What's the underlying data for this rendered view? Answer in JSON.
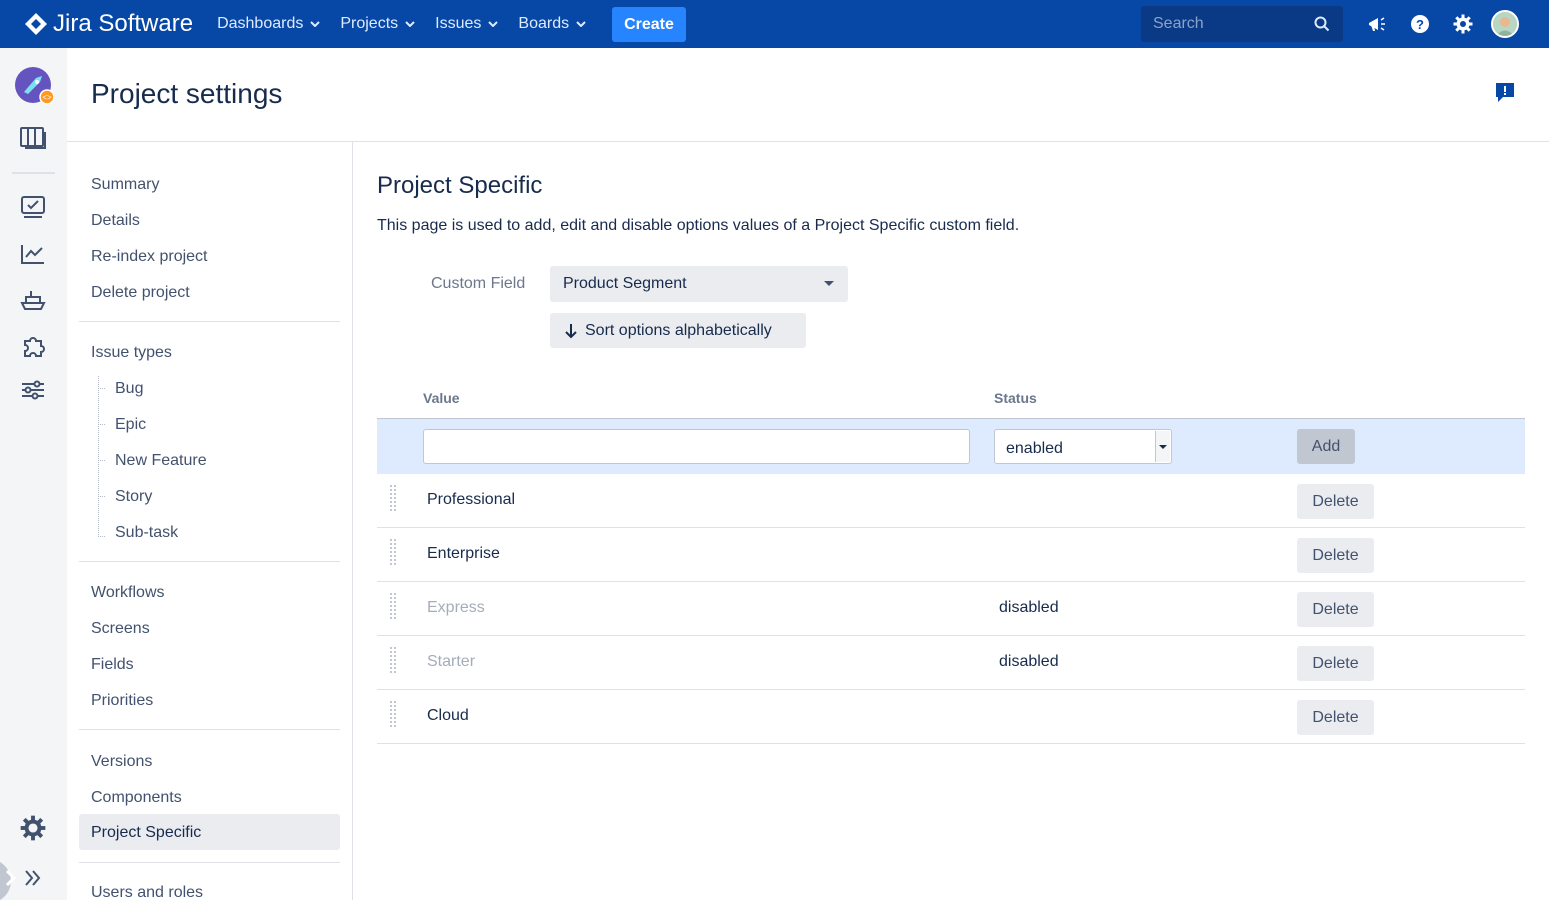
{
  "topnav": {
    "brand": "Jira Software",
    "menu": [
      {
        "label": "Dashboards"
      },
      {
        "label": "Projects"
      },
      {
        "label": "Issues"
      },
      {
        "label": "Boards"
      }
    ],
    "create_label": "Create",
    "search_placeholder": "Search",
    "icons": [
      "announcement-icon",
      "help-icon",
      "settings-icon",
      "user-avatar"
    ]
  },
  "leftbar": {
    "icons": [
      "project-avatar",
      "board-icon",
      "backlog-icon",
      "reports-icon",
      "releases-icon",
      "add-ons-icon",
      "project-settings-icon",
      "settings-icon",
      "expand-icon"
    ]
  },
  "header": {
    "title": "Project settings",
    "feedback_icon": "feedback-icon"
  },
  "settings_nav": {
    "group1": [
      "Summary",
      "Details",
      "Re-index project",
      "Delete project"
    ],
    "issue_types_label": "Issue types",
    "issue_types": [
      "Bug",
      "Epic",
      "New Feature",
      "Story",
      "Sub-task"
    ],
    "group3": [
      "Workflows",
      "Screens",
      "Fields",
      "Priorities"
    ],
    "group4": [
      "Versions",
      "Components",
      "Project Specific"
    ],
    "group5": [
      "Users and roles"
    ],
    "active": "Project Specific"
  },
  "main": {
    "heading": "Project Specific",
    "description": "This page is used to add, edit and disable options values of a Project Specific custom field.",
    "custom_field_label": "Custom Field",
    "custom_field_value": "Product Segment",
    "sort_label": "Sort options alphabetically",
    "table": {
      "headers": {
        "value": "Value",
        "status": "Status"
      },
      "new_row": {
        "value": "",
        "status": "enabled",
        "add_label": "Add"
      },
      "rows": [
        {
          "value": "Professional",
          "status": "",
          "disabled": false,
          "action": "Delete"
        },
        {
          "value": "Enterprise",
          "status": "",
          "disabled": false,
          "action": "Delete"
        },
        {
          "value": "Express",
          "status": "disabled",
          "disabled": true,
          "action": "Delete"
        },
        {
          "value": "Starter",
          "status": "disabled",
          "disabled": true,
          "action": "Delete"
        },
        {
          "value": "Cloud",
          "status": "",
          "disabled": false,
          "action": "Delete"
        }
      ]
    }
  },
  "colors": {
    "nav_bg": "#0747a6",
    "create_bg": "#2684ff",
    "add_row_bg": "#deebff"
  }
}
